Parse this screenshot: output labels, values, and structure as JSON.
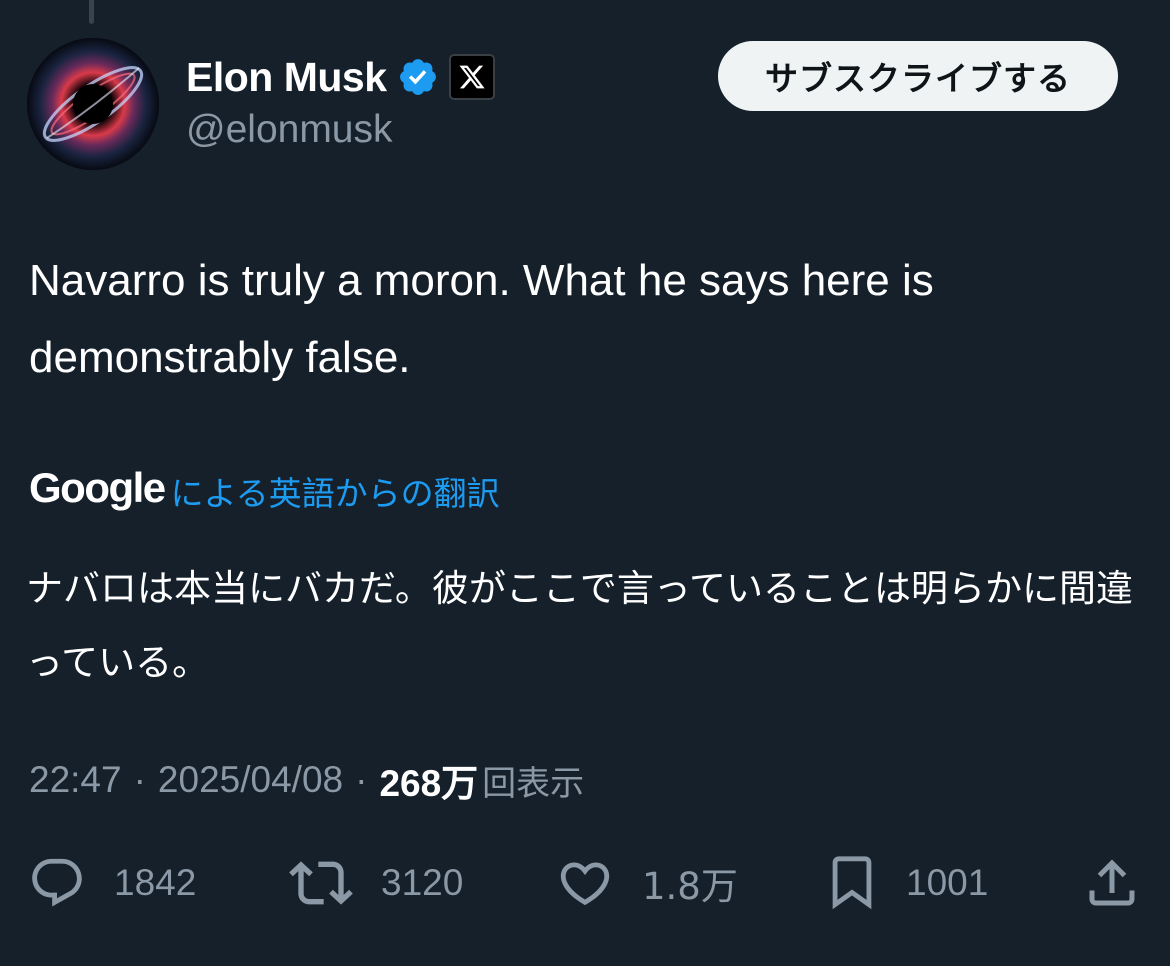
{
  "author": {
    "display_name": "Elon Musk",
    "handle": "@elonmusk",
    "verified": true,
    "affiliate_badge_icon": "x-logo-icon"
  },
  "subscribe_button": {
    "label": "サブスクライブする"
  },
  "tweet": {
    "text": "Navarro is truly a moron. What he says here is demonstrably false."
  },
  "translation": {
    "provider": "Google",
    "link_label": "による英語からの翻訳",
    "text": "ナバロは本当にバカだ。彼がここで言っていることは明らかに間違っている。"
  },
  "meta": {
    "time": "22:47",
    "separator": "·",
    "date": "2025/04/08",
    "views_count": "268万",
    "views_label": "回表示"
  },
  "actions": {
    "replies": "1842",
    "retweets": "3120",
    "likes": "1.8万",
    "bookmarks": "1001"
  },
  "colors": {
    "background": "#15202b",
    "link": "#1d9bf0",
    "verified": "#1d9bf0",
    "muted_text": "#8b98a5",
    "primary_text": "#ffffff",
    "subscribe_bg": "#eff3f4"
  }
}
